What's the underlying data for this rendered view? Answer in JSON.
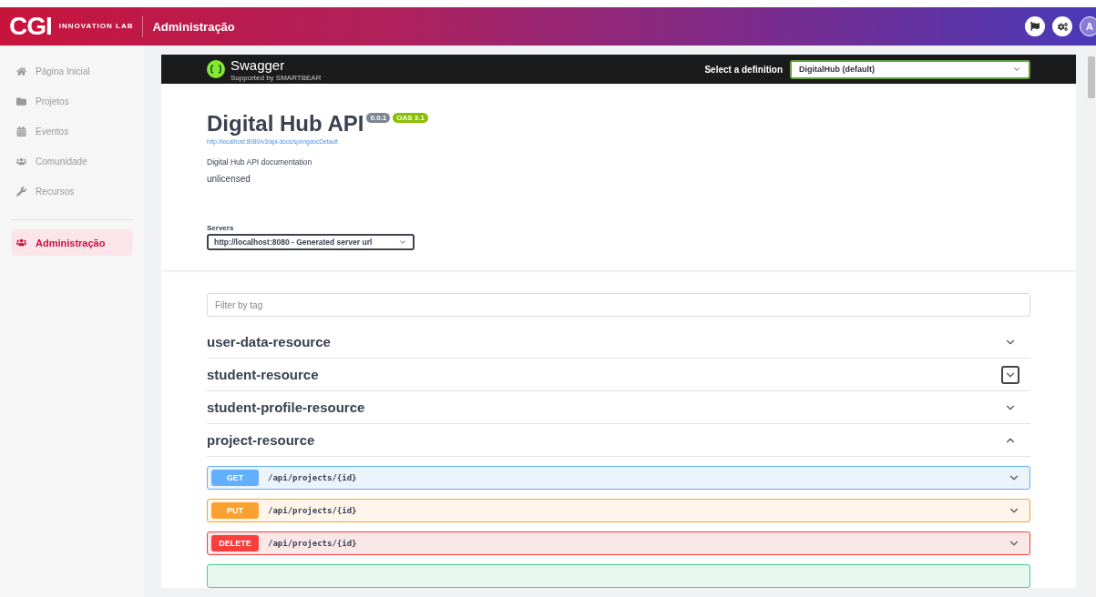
{
  "header": {
    "logo": "CGI",
    "logo_sub": "INNOVATION LAB",
    "title": "Administração",
    "avatar": "A"
  },
  "sidebar": {
    "items": [
      {
        "label": "Página Inicial",
        "selected": false
      },
      {
        "label": "Projetos",
        "selected": false
      },
      {
        "label": "Eventos",
        "selected": false
      },
      {
        "label": "Comunidade",
        "selected": false
      },
      {
        "label": "Recursos",
        "selected": false
      }
    ],
    "admin_item": {
      "label": "Administração",
      "selected": true
    }
  },
  "swagger": {
    "brand": "Swagger",
    "brand_sub": "Supported by SMARTBEAR",
    "definition_label": "Select a definition",
    "definition_value": "DigitalHub (default)",
    "title": "Digital Hub API",
    "version": "0.0.1",
    "oas": "OAS 3.1",
    "spec_link": "http://localhost:8080/v3/api-docs/springdocDefault",
    "description": "Digital Hub API documentation",
    "license": "unlicensed",
    "servers_label": "Servers",
    "server_value": "http://localhost:8080 - Generated server url",
    "filter_placeholder": "Filter by tag",
    "tags": [
      {
        "name": "user-data-resource",
        "expanded": false,
        "focused": false
      },
      {
        "name": "student-resource",
        "expanded": false,
        "focused": true
      },
      {
        "name": "student-profile-resource",
        "expanded": false,
        "focused": false
      },
      {
        "name": "project-resource",
        "expanded": true,
        "focused": false
      }
    ],
    "operations": [
      {
        "kind": "get",
        "method": "GET",
        "path": "/api/projects/{id}"
      },
      {
        "kind": "put",
        "method": "PUT",
        "path": "/api/projects/{id}"
      },
      {
        "kind": "delete",
        "method": "DELETE",
        "path": "/api/projects/{id}"
      },
      {
        "kind": "post"
      }
    ]
  }
}
